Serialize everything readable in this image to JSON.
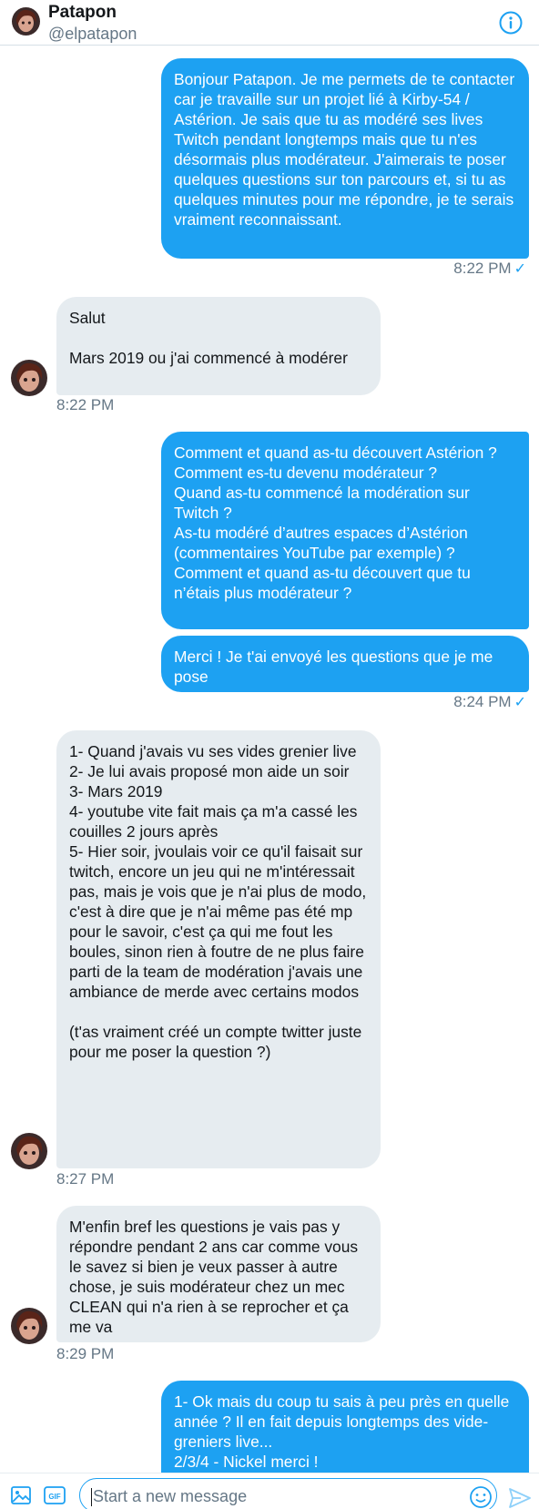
{
  "header": {
    "name": "Patapon",
    "handle": "@elpatapon"
  },
  "messages": [
    {
      "text": "Bonjour Patapon. Je me permets de te contacter car je travaille sur un projet lié à Kirby-54 / Astérion. Je sais que tu as modéré ses lives Twitch pendant longtemps mais que tu n'es désormais plus modérateur. J'aimerais te poser quelques questions sur ton parcours et, si tu as quelques minutes pour me répondre, je te serais vraiment reconnaissant."
    },
    {
      "time": "8:22 PM"
    },
    {
      "text": "Salut\n\nMars 2019 ou j'ai commencé à modérer",
      "time": "8:22 PM"
    },
    {
      "text": "Comment et quand as-tu découvert Astérion ?\nComment es-tu devenu modérateur ?\nQuand as-tu commencé la modération sur Twitch ?\nAs-tu modéré d’autres espaces d’Astérion (commentaires YouTube par exemple) ?\nComment et quand as-tu découvert que tu n’étais plus modérateur ?"
    },
    {
      "text": "Merci ! Je t'ai envoyé les questions que je me pose",
      "time": "8:24 PM"
    },
    {
      "text": "1- Quand j'avais vu ses vides grenier live\n2- Je lui avais proposé mon aide un soir\n3- Mars 2019\n4- youtube vite fait mais ça m'a cassé les couilles 2 jours après\n5- Hier soir, jvoulais voir ce qu'il faisait sur twitch, encore un jeu qui ne m'intéressait pas, mais je vois que je n'ai plus de modo, c'est à dire que je n'ai même pas été mp pour le savoir, c'est ça qui me fout les boules, sinon rien à foutre de ne plus faire parti de la team de modération j'avais une ambiance de merde avec certains modos\n\n(t'as vraiment créé un compte twitter juste pour me poser la question ?)",
      "time": "8:27 PM"
    },
    {
      "text": "M'enfin bref les questions je vais pas y répondre pendant 2 ans car comme vous le savez si bien je veux passer à autre chose, je suis modérateur chez un mec CLEAN qui n'a rien à se reprocher et ça me va",
      "time": "8:29 PM"
    },
    {
      "text": "1- Ok mais du coup tu sais à peu près en quelle année ? Il en fait depuis longtemps des vide-greniers live...\n2/3/4 - Nickel merci !"
    }
  ],
  "composer": {
    "placeholder": "Start a new message"
  },
  "colors": {
    "accent": "#1da1f2",
    "incoming_bubble": "#e6ecf0",
    "muted_text": "#657786"
  },
  "icons": [
    "info-icon",
    "media-icon",
    "gif-icon",
    "emoji-icon",
    "send-icon",
    "read-check-icon"
  ]
}
